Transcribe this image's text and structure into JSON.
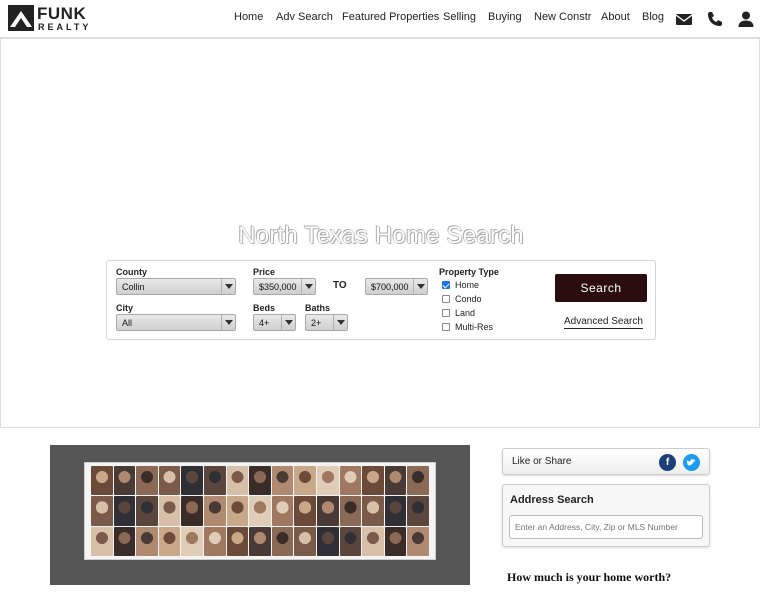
{
  "logo": {
    "brand": "FUNK",
    "sub": "REALTY"
  },
  "nav": {
    "items": [
      {
        "label": "Home"
      },
      {
        "label": "Adv Search"
      },
      {
        "label": "Featured Properties"
      },
      {
        "label": "Selling"
      },
      {
        "label": "Buying"
      },
      {
        "label": "New Constr"
      },
      {
        "label": "About"
      },
      {
        "label": "Blog"
      }
    ],
    "icons": [
      "envelope-icon",
      "phone-icon",
      "user-icon"
    ]
  },
  "hero": {
    "title": "North Texas Home Search"
  },
  "search": {
    "county_label": "County",
    "county_value": "Collin",
    "city_label": "City",
    "city_value": "All",
    "price_label": "Price",
    "price_min": "$350,000",
    "to_label": "TO",
    "price_max": "$700,000",
    "beds_label": "Beds",
    "beds_value": "4+",
    "baths_label": "Baths",
    "baths_value": "2+",
    "property_type_label": "Property Type",
    "property_types": [
      {
        "label": "Home",
        "checked": true
      },
      {
        "label": "Condo",
        "checked": false
      },
      {
        "label": "Land",
        "checked": false
      },
      {
        "label": "Multi-Res",
        "checked": false
      }
    ],
    "search_button": "Search",
    "advanced_link": "Advanced Search"
  },
  "share": {
    "label": "Like or Share",
    "icons": [
      "facebook-icon",
      "twitter-icon"
    ],
    "colors": {
      "facebook": "#1c3f7a",
      "twitter": "#1d9bf0"
    }
  },
  "address_search": {
    "title": "Address Search",
    "placeholder": "Enter an Address, City, Zip or MLS Number"
  },
  "home_worth": {
    "title": "How much is your home worth?"
  },
  "colors": {
    "search_button": "#2b0d0d",
    "photo_panel": "#555555"
  }
}
